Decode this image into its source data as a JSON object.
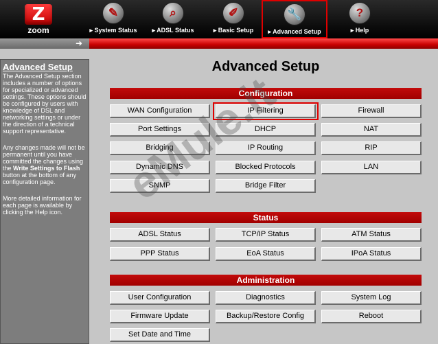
{
  "logo": {
    "mark": "Z",
    "text": "zoom"
  },
  "nav": [
    {
      "label": "▸ System Status",
      "icon": "folder-icon",
      "glyph": "✎"
    },
    {
      "label": "▸ ADSL Status",
      "icon": "magnifier-icon",
      "glyph": "⌕"
    },
    {
      "label": "▸ Basic Setup",
      "icon": "pen-icon",
      "glyph": "✐"
    },
    {
      "label": "▸ Advanced Setup",
      "icon": "wrench-icon",
      "glyph": "🔧",
      "active": true
    },
    {
      "label": "▸ Help",
      "icon": "question-icon",
      "glyph": "?"
    }
  ],
  "sidebar": {
    "title": "Advanced Setup",
    "para1": "The Advanced Setup section includes a number of options for specialized or advanced settings. These options should be configured by users with knowledge of DSL and networking settings or under the direction of a technical support representative.",
    "para2_a": "Any changes made will not be permanent until you have committed the changes using the ",
    "para2_b": "Write Settings to Flash",
    "para2_c": " button at the bottom of any configuration page.",
    "para3": "More detailed information for each page is available by clicking the Help icon."
  },
  "page_title": "Advanced Setup",
  "sections": {
    "configuration": "Configuration",
    "status": "Status",
    "administration": "Administration"
  },
  "buttons": {
    "config": [
      "WAN Configuration",
      "IP Filtering",
      "Firewall",
      "Port Settings",
      "DHCP",
      "NAT",
      "Bridging",
      "IP Routing",
      "RIP",
      "Dynamic DNS",
      "Blocked Protocols",
      "LAN",
      "SNMP",
      "Bridge Filter"
    ],
    "status": [
      "ADSL Status",
      "TCP/IP Status",
      "ATM Status",
      "PPP Status",
      "EoA Status",
      "IPoA Status"
    ],
    "admin": [
      "User Configuration",
      "Diagnostics",
      "System Log",
      "Firmware Update",
      "Backup/Restore Config",
      "Reboot",
      "Set Date and Time"
    ]
  },
  "watermark": "eMule.it",
  "colors": {
    "accent": "#c80000",
    "highlight": "#e00000",
    "sidebar": "#7d7d7d"
  }
}
